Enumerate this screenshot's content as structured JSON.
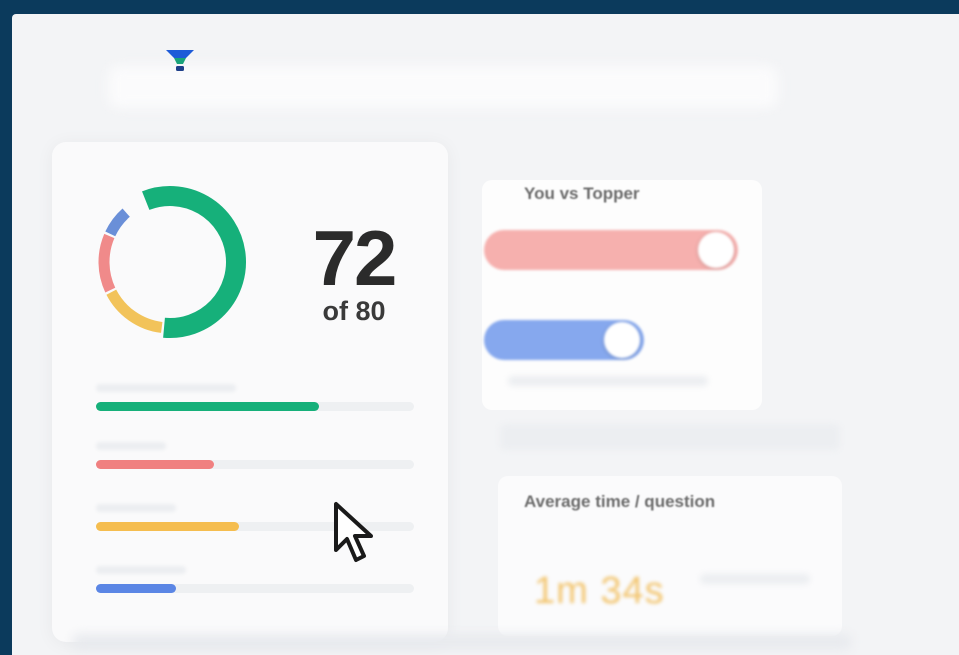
{
  "header": {
    "logo_icon": "funnel-logo-icon"
  },
  "score": {
    "value": "72",
    "total_text": "of 80",
    "obtained": 72,
    "max": 80
  },
  "donut": {
    "segments": [
      {
        "color": "#16b07a",
        "fraction": 0.58
      },
      {
        "color": "#f2c35a",
        "fraction": 0.16
      },
      {
        "color": "#f08a8a",
        "fraction": 0.14
      },
      {
        "color": "#6a8fd8",
        "fraction": 0.07
      }
    ]
  },
  "section_bars": [
    {
      "color": "#16b07a",
      "fraction": 0.7
    },
    {
      "color": "#f08080",
      "fraction": 0.37
    },
    {
      "color": "#f5bd4f",
      "fraction": 0.45
    },
    {
      "color": "#5b86e5",
      "fraction": 0.25
    }
  ],
  "comparison": {
    "title": "You vs Topper",
    "bars": [
      {
        "color": "#f6b0ae",
        "fraction": 1.0
      },
      {
        "color": "#86a8ee",
        "fraction": 1.0
      }
    ]
  },
  "time": {
    "title": "Average time / question",
    "value": "1m 34s",
    "color": "#f2c46d"
  },
  "cursor": {
    "icon": "mouse-pointer-icon"
  }
}
